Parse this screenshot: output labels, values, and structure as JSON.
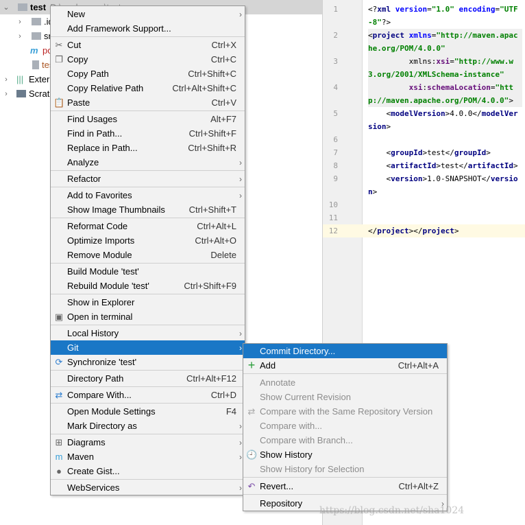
{
  "tree": {
    "root": "test",
    "root_path": "D:\\workspace\\test",
    "children": [
      ".idea",
      "src",
      "pom.xml",
      "test.iml"
    ],
    "external": "External Libraries",
    "scratches": "Scratches and Consoles"
  },
  "editor": {
    "lines": [
      [
        "1",
        "<?xml version=\"1.0\" encoding=\"UTF-8\"?>"
      ],
      [
        "2",
        "<project xmlns=\"http://maven.apache.org/POM/4.0.0\""
      ],
      [
        "3",
        "         xmlns:xsi=\"http://www.w3.org/2001/XMLSchema-instance\""
      ],
      [
        "4",
        "         xsi:schemaLocation=\"http://maven.apache.org/POM/4.0.0\">"
      ],
      [
        "5",
        "    <modelVersion>4.0.0</modelVersion>"
      ],
      [
        "6",
        ""
      ],
      [
        "7",
        "    <groupId>test</groupId>"
      ],
      [
        "8",
        "    <artifactId>test</artifactId>"
      ],
      [
        "9",
        "    <version>1.0-SNAPSHOT</version>"
      ],
      [
        "10",
        ""
      ],
      [
        "11",
        ""
      ],
      [
        "12",
        "</project></project>"
      ]
    ]
  },
  "main_menu": [
    {
      "label": "New",
      "arrow": true
    },
    {
      "label": "Add Framework Support..."
    },
    {
      "sep": true
    },
    {
      "label": "Cut",
      "shortcut": "Ctrl+X",
      "icon": "scissors-icon",
      "glyph": "✂"
    },
    {
      "label": "Copy",
      "shortcut": "Ctrl+C",
      "icon": "copy-icon",
      "glyph": "❐"
    },
    {
      "label": "Copy Path",
      "shortcut": "Ctrl+Shift+C"
    },
    {
      "label": "Copy Relative Path",
      "shortcut": "Ctrl+Alt+Shift+C"
    },
    {
      "label": "Paste",
      "shortcut": "Ctrl+V",
      "icon": "paste-icon",
      "glyph": "📋"
    },
    {
      "sep": true
    },
    {
      "label": "Find Usages",
      "shortcut": "Alt+F7"
    },
    {
      "label": "Find in Path...",
      "shortcut": "Ctrl+Shift+F"
    },
    {
      "label": "Replace in Path...",
      "shortcut": "Ctrl+Shift+R"
    },
    {
      "label": "Analyze",
      "arrow": true
    },
    {
      "sep": true
    },
    {
      "label": "Refactor",
      "arrow": true
    },
    {
      "sep": true
    },
    {
      "label": "Add to Favorites",
      "arrow": true
    },
    {
      "label": "Show Image Thumbnails",
      "shortcut": "Ctrl+Shift+T"
    },
    {
      "sep": true
    },
    {
      "label": "Reformat Code",
      "shortcut": "Ctrl+Alt+L"
    },
    {
      "label": "Optimize Imports",
      "shortcut": "Ctrl+Alt+O"
    },
    {
      "label": "Remove Module",
      "shortcut": "Delete"
    },
    {
      "sep": true
    },
    {
      "label": "Build Module 'test'"
    },
    {
      "label": "Rebuild Module 'test'",
      "shortcut": "Ctrl+Shift+F9"
    },
    {
      "sep": true
    },
    {
      "label": "Show in Explorer"
    },
    {
      "label": "Open in terminal",
      "icon": "terminal-icon",
      "glyph": "▣"
    },
    {
      "sep": true
    },
    {
      "label": "Local History",
      "arrow": true
    },
    {
      "label": "Git",
      "arrow": true,
      "active": true
    },
    {
      "label": "Synchronize 'test'",
      "icon": "sync-icon",
      "glyph": "⟳"
    },
    {
      "sep": true
    },
    {
      "label": "Directory Path",
      "shortcut": "Ctrl+Alt+F12"
    },
    {
      "sep": true
    },
    {
      "label": "Compare With...",
      "shortcut": "Ctrl+D",
      "icon": "compare-icon",
      "glyph": "⇄"
    },
    {
      "sep": true
    },
    {
      "label": "Open Module Settings",
      "shortcut": "F4"
    },
    {
      "label": "Mark Directory as",
      "arrow": true
    },
    {
      "sep": true
    },
    {
      "label": "Diagrams",
      "arrow": true,
      "icon": "diagram-icon",
      "glyph": "⊞"
    },
    {
      "label": "Maven",
      "arrow": true,
      "icon": "maven-icon",
      "glyph": "m"
    },
    {
      "label": "Create Gist...",
      "icon": "github-icon",
      "glyph": "●"
    },
    {
      "sep": true
    },
    {
      "label": "WebServices",
      "arrow": true
    }
  ],
  "git_menu": [
    {
      "label": "Commit Directory...",
      "active": true
    },
    {
      "label": "Add",
      "shortcut": "Ctrl+Alt+A",
      "icon": "plus-icon",
      "glyph": "+"
    },
    {
      "sep": true
    },
    {
      "label": "Annotate",
      "disabled": true
    },
    {
      "label": "Show Current Revision",
      "disabled": true
    },
    {
      "label": "Compare with the Same Repository Version",
      "disabled": true,
      "icon": "compare-icon",
      "glyph": "⇄"
    },
    {
      "label": "Compare with...",
      "disabled": true
    },
    {
      "label": "Compare with Branch...",
      "disabled": true
    },
    {
      "label": "Show History",
      "icon": "history-icon",
      "glyph": "🕘"
    },
    {
      "label": "Show History for Selection",
      "disabled": true
    },
    {
      "sep": true
    },
    {
      "label": "Revert...",
      "shortcut": "Ctrl+Alt+Z",
      "icon": "revert-icon",
      "glyph": "↶"
    },
    {
      "sep": true
    },
    {
      "label": "Repository",
      "arrow": true
    }
  ],
  "watermark": "https://blog.csdn.net/sha1024",
  "colors": {
    "highlight": "#1a77c6",
    "menu_bg": "#f2f2f2",
    "disabled": "#8c8c8c"
  }
}
